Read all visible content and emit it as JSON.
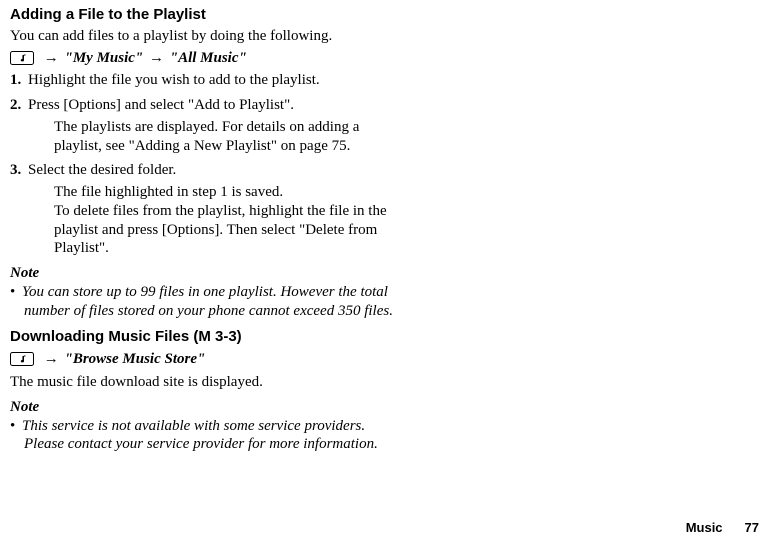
{
  "section1": {
    "title": "Adding a File to the Playlist",
    "intro": "You can add files to a playlist by doing the following.",
    "path": {
      "arrow1": "→",
      "item1": "\"My Music\"",
      "arrow2": "→",
      "item2": "\"All Music\""
    },
    "steps": [
      {
        "num": "1.",
        "text": "Highlight the file you wish to add to the playlist."
      },
      {
        "num": "2.",
        "text": "Press [Options] and select \"Add to Playlist\".",
        "sub": "The playlists are displayed. For details on adding a playlist, see \"Adding a New Playlist\" on page 75."
      },
      {
        "num": "3.",
        "text": "Select the desired folder.",
        "sub": "The file highlighted in step 1 is saved.\nTo delete files from the playlist, highlight the file in the playlist and press [Options]. Then select \"Delete from Playlist\"."
      }
    ],
    "note_label": "Note",
    "note_bullet": "•",
    "note_text": "You can store up to 99 files in one playlist. However the total number of files stored on your phone cannot exceed 350 files."
  },
  "section2": {
    "title": "Downloading Music Files (M 3-3)",
    "path": {
      "arrow1": "→",
      "item1": "\"Browse Music Store\""
    },
    "body": "The music file download site is displayed.",
    "note_label": "Note",
    "note_bullet": "•",
    "note_text": "This service is not available with some service providers. Please contact your service provider for more information."
  },
  "footer": {
    "category": "Music",
    "page": "77"
  }
}
